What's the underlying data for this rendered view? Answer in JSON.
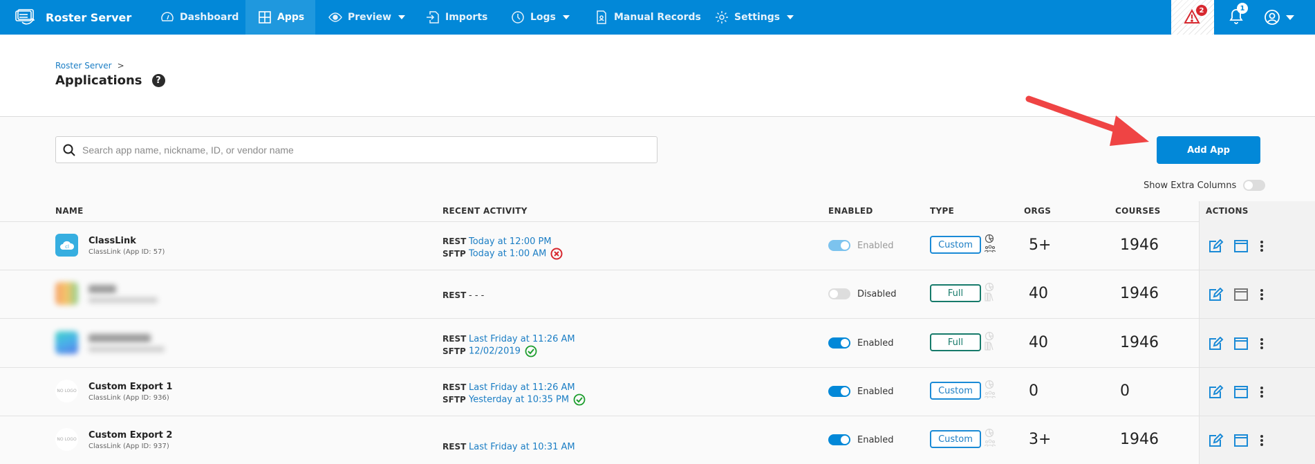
{
  "topbar": {
    "brand": "Roster Server",
    "nav": [
      {
        "label": "Dashboard",
        "icon": "dashboard-icon"
      },
      {
        "label": "Apps",
        "icon": "apps-grid-icon",
        "active": true
      },
      {
        "label": "Preview",
        "icon": "eye-icon",
        "dropdown": true
      },
      {
        "label": "Imports",
        "icon": "import-icon"
      },
      {
        "label": "Logs",
        "icon": "clock-icon",
        "dropdown": true
      },
      {
        "label": "Manual Records",
        "icon": "record-icon"
      },
      {
        "label": "Settings",
        "icon": "gear-icon",
        "dropdown": true
      }
    ],
    "alerts_count": "2",
    "notifications_count": "1"
  },
  "header": {
    "breadcrumb": "Roster Server",
    "title": "Applications"
  },
  "search": {
    "placeholder": "Search app name, nickname, ID, or vendor name",
    "value": ""
  },
  "add_app_label": "Add App",
  "show_extra_columns": {
    "label": "Show Extra Columns",
    "on": false
  },
  "columns": [
    "NAME",
    "RECENT ACTIVITY",
    "ENABLED",
    "TYPE",
    "ORGS",
    "COURSES",
    "ACTIONS"
  ],
  "rows": [
    {
      "name": "ClassLink",
      "sub": "ClassLink (App ID: 57)",
      "logo": "classlink",
      "activity": [
        {
          "proto": "REST",
          "time": "Today at 12:00 PM",
          "status": ""
        },
        {
          "proto": "SFTP",
          "time": "Today at 1:00 AM",
          "status": "error"
        }
      ],
      "enabled": true,
      "enabled_label": "Enabled",
      "type": "Custom",
      "orgs": "5+",
      "courses": "1946"
    },
    {
      "name": "(blurred)",
      "sub": "(blurred)",
      "logo": "blurred",
      "activity": [
        {
          "proto": "REST",
          "time": "- - -",
          "status": ""
        }
      ],
      "enabled": false,
      "enabled_label": "Disabled",
      "type": "Full",
      "orgs": "40",
      "courses": "1946"
    },
    {
      "name": "(blurred)",
      "sub": "(blurred)",
      "logo": "blurred",
      "activity": [
        {
          "proto": "REST",
          "time": "Last Friday at 11:26 AM",
          "status": ""
        },
        {
          "proto": "SFTP",
          "time": "12/02/2019",
          "status": "success"
        }
      ],
      "enabled": true,
      "enabled_label": "Enabled",
      "type": "Full",
      "orgs": "40",
      "courses": "1946"
    },
    {
      "name": "Custom Export 1",
      "sub": "ClassLink (App ID: 936)",
      "logo": "NO LOGO",
      "activity": [
        {
          "proto": "REST",
          "time": "Last Friday at 11:26 AM",
          "status": ""
        },
        {
          "proto": "SFTP",
          "time": "Yesterday at 10:35 PM",
          "status": "success"
        }
      ],
      "enabled": true,
      "enabled_label": "Enabled",
      "type": "Custom",
      "orgs": "0",
      "courses": "0"
    },
    {
      "name": "Custom Export 2",
      "sub": "ClassLink (App ID: 937)",
      "logo": "NO LOGO",
      "activity": [
        {
          "proto": "REST",
          "time": "Last Friday at 10:31 AM",
          "status": ""
        }
      ],
      "enabled": true,
      "enabled_label": "Enabled",
      "type": "Custom",
      "orgs": "3+",
      "courses": "1946"
    }
  ],
  "colors": {
    "primary": "#0288d8",
    "link": "#1a7dc4",
    "full_type": "#167a6a",
    "error": "#d7282f",
    "success": "#1e9e2e",
    "arrow": "#ef4444"
  }
}
